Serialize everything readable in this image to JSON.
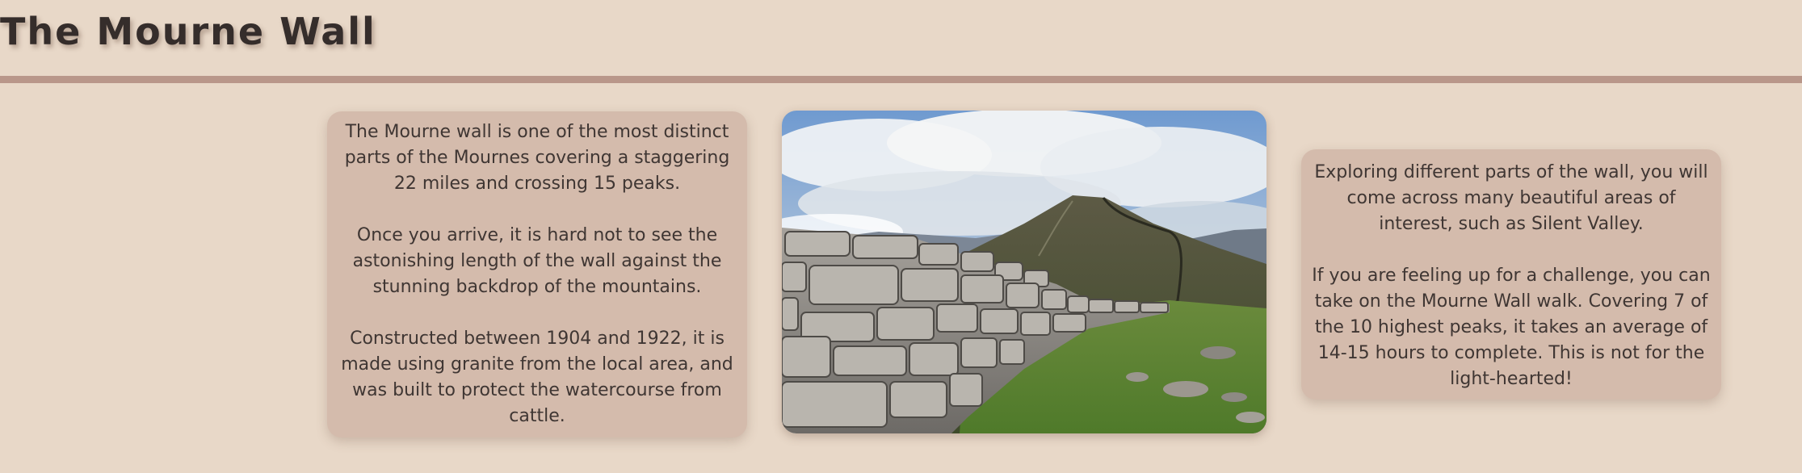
{
  "header": {
    "title": "The Mourne Wall"
  },
  "left_card": {
    "paragraphs": [
      "The Mourne wall is one of the most distinct parts of the Mournes covering a staggering 22 miles and crossing 15 peaks.",
      "Once you arrive, it is hard not to see the astonishing length of the wall against the stunning backdrop of the mountains.",
      "Constructed between 1904 and 1922, it is made using granite from the local area, and was built to protect the watercourse from cattle."
    ]
  },
  "right_card": {
    "paragraphs": [
      "Exploring different parts of the wall, you will come across many beautiful areas of interest, such as Silent Valley.",
      "If you are feeling up for a challenge, you can take on the Mourne Wall walk. Covering 7 of the 10 highest peaks, it takes an average of 14-15 hours to complete. This is not for the light-hearted!"
    ]
  },
  "photo": {
    "subject": "stone-wall-mountain-photo"
  },
  "colors": {
    "background": "#e8d8c8",
    "card": "#d4bbac",
    "divider": "#b9978a",
    "title_text": "#352d2b",
    "body_text": "#3f3633"
  }
}
